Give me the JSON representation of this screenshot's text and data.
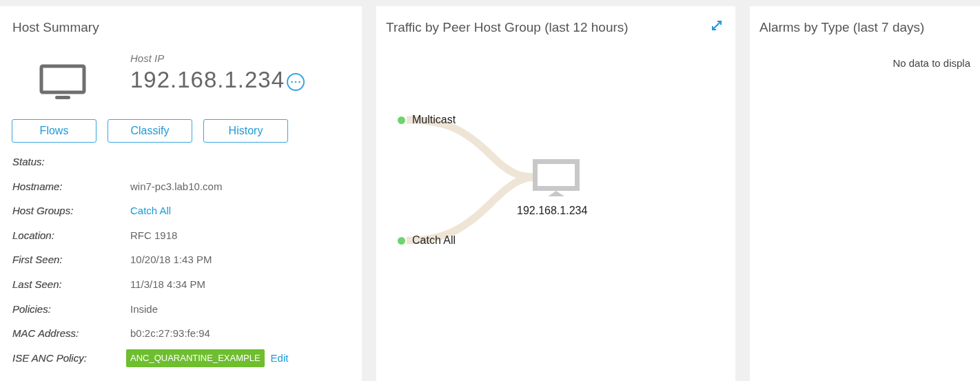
{
  "host_summary": {
    "title": "Host Summary",
    "host_ip_label": "Host IP",
    "host_ip": "192.168.1.234",
    "buttons": [
      "Flows",
      "Classify",
      "History"
    ],
    "fields": [
      {
        "label": "Status:",
        "kind": "empty"
      },
      {
        "label": "Hostname:",
        "kind": "text",
        "value": "win7-pc3.lab10.com"
      },
      {
        "label": "Host Groups:",
        "kind": "link",
        "value": "Catch All"
      },
      {
        "label": "Location:",
        "kind": "text",
        "value": "RFC 1918"
      },
      {
        "label": "First Seen:",
        "kind": "text",
        "value": "10/20/18 1:43 PM"
      },
      {
        "label": "Last Seen:",
        "kind": "text",
        "value": "11/3/18 4:34 PM"
      },
      {
        "label": "Policies:",
        "kind": "text",
        "value": "Inside"
      },
      {
        "label": "MAC Address:",
        "kind": "text",
        "value": "b0:2c:27:93:fe:94"
      },
      {
        "label": "ISE ANC Policy:",
        "kind": "policy",
        "value": "ANC_QUARANTINE_EXAMPLE",
        "action": "Edit"
      }
    ]
  },
  "traffic": {
    "title": "Traffic by Peer Host Group (last 12 hours)",
    "peers": [
      {
        "name": "Multicast",
        "color": "#6dd46d"
      },
      {
        "name": "Catch All",
        "color": "#6dd46d"
      }
    ],
    "host": "192.168.1.234"
  },
  "alarms": {
    "title": "Alarms by Type (last 7 days)",
    "message": "No data to displa"
  }
}
